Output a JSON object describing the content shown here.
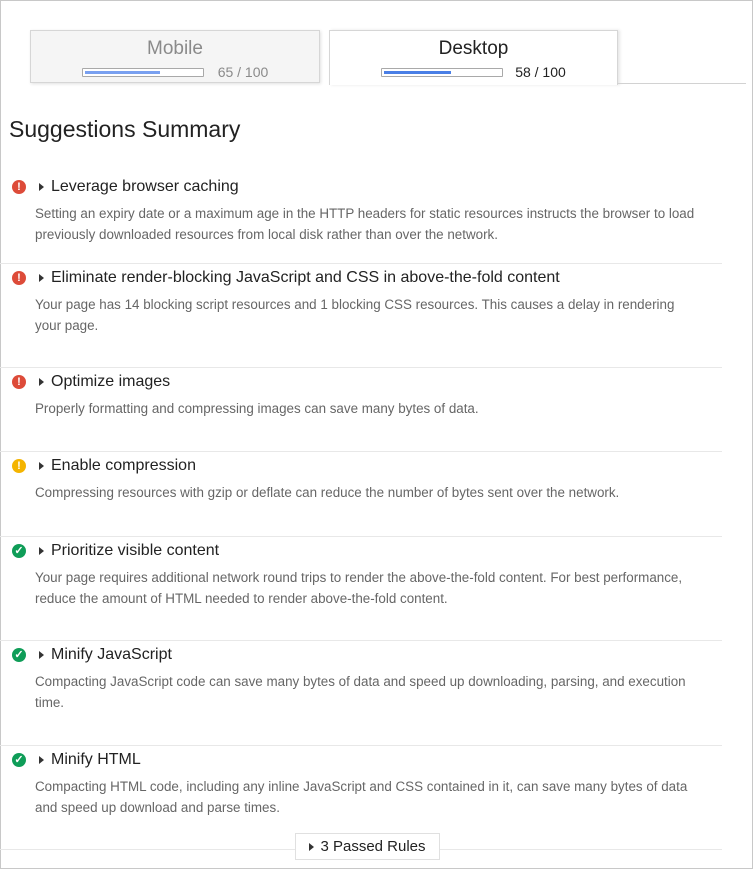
{
  "tabs": [
    {
      "label": "Mobile",
      "score": 65,
      "score_text": "65 / 100",
      "active": false
    },
    {
      "label": "Desktop",
      "score": 58,
      "score_text": "58 / 100",
      "active": true
    }
  ],
  "heading": "Suggestions Summary",
  "rules": [
    {
      "status": "error",
      "icon": "exclamation-icon",
      "title": "Leverage browser caching",
      "description": "Setting an expiry date or a maximum age in the HTTP headers for static resources instructs the browser to load previously downloaded resources from local disk rather than over the network."
    },
    {
      "status": "error",
      "icon": "exclamation-icon",
      "title": "Eliminate render-blocking JavaScript and CSS in above-the-fold content",
      "description": "Your page has 14 blocking script resources and 1 blocking CSS resources. This causes a delay in rendering your page."
    },
    {
      "status": "error",
      "icon": "exclamation-icon",
      "title": "Optimize images",
      "description": "Properly formatting and compressing images can save many bytes of data."
    },
    {
      "status": "warning",
      "icon": "exclamation-icon",
      "title": "Enable compression",
      "description": "Compressing resources with gzip or deflate can reduce the number of bytes sent over the network."
    },
    {
      "status": "pass",
      "icon": "check-icon",
      "title": "Prioritize visible content",
      "description": "Your page requires additional network round trips to render the above-the-fold content. For best performance, reduce the amount of HTML needed to render above-the-fold content."
    },
    {
      "status": "pass",
      "icon": "check-icon",
      "title": "Minify JavaScript",
      "description": "Compacting JavaScript code can save many bytes of data and speed up downloading, parsing, and execution time."
    },
    {
      "status": "pass",
      "icon": "check-icon",
      "title": "Minify HTML",
      "description": "Compacting HTML code, including any inline JavaScript and CSS contained in it, can save many bytes of data and speed up download and parse times."
    }
  ],
  "passed_rules_label": "3 Passed Rules",
  "colors": {
    "error": "#dd4b39",
    "warning": "#f4b400",
    "pass": "#0f9d58",
    "score_bar_active": "#4a7fe6",
    "score_bar_inactive": "#79a0f0"
  }
}
